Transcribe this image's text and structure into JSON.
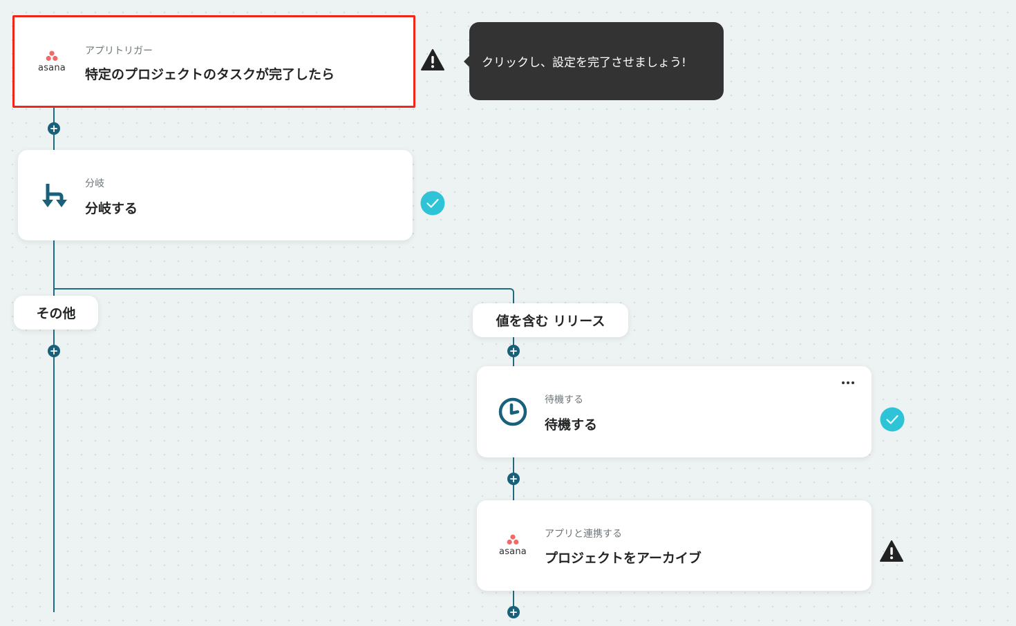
{
  "tooltip": {
    "text": "クリックし、設定を完了させましょう!"
  },
  "nodes": {
    "trigger": {
      "category": "アプリトリガー",
      "title": "特定のプロジェクトのタスクが完了したら",
      "app_name": "asana",
      "status": "warning",
      "selected": true
    },
    "branch": {
      "category": "分岐",
      "title": "分岐する",
      "status": "complete"
    },
    "wait": {
      "category": "待機する",
      "title": "待機する",
      "status": "complete"
    },
    "archive": {
      "category": "アプリと連携する",
      "title": "プロジェクトをアーカイブ",
      "app_name": "asana",
      "status": "warning"
    }
  },
  "branches": {
    "other_label": "その他",
    "condition_label": "値を含む リリース"
  },
  "colors": {
    "connector": "#1f6a80",
    "add_button": "#19607a",
    "selected_border": "#f0261a",
    "check_badge": "#2ec3d6",
    "asana_dot": "#f06a6a",
    "tooltip_bg": "#333333"
  },
  "icons": {
    "add": "plus-icon",
    "complete": "check-circle-icon",
    "warning": "warning-triangle-icon",
    "branch": "branch-arrows-icon",
    "wait": "clock-icon",
    "more": "more-dots-icon"
  }
}
